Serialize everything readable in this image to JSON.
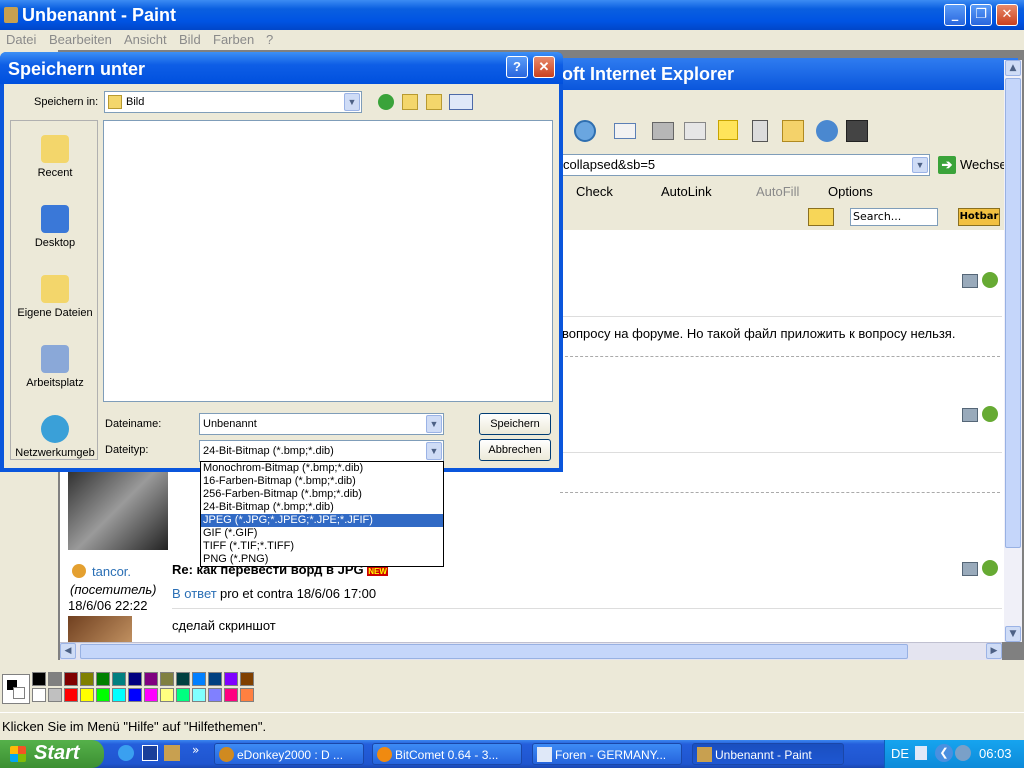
{
  "paint": {
    "title": "Unbenannt - Paint",
    "menu": [
      "Datei",
      "Bearbeiten",
      "Ansicht",
      "Bild",
      "Farben",
      "?"
    ],
    "status": "Klicken Sie im Menü \"Hilfe\" auf \"Hilfethemen\"."
  },
  "ie": {
    "title": "oft Internet Explorer",
    "address": "collapsed&sb=5",
    "go_label": "Wechse",
    "google": {
      "check": "Check",
      "autolink": "AutoLink",
      "autofill": "AutoFill",
      "options": "Options"
    },
    "hotbar": {
      "search_placeholder": "Search...",
      "hotbar_label": "Hotbar"
    },
    "post1_text": "вопросу на форуме. Но такой файл приложить к вопросу нельзя.",
    "post_user": "tancor.",
    "post_role": "(посетитель)",
    "post_date": "18/6/06 22:22",
    "reply_title": "Re: как перевести ворд в JPG",
    "reply_new_badge": "NEW",
    "reply_link": "В ответ",
    "reply_meta": "pro et contra 18/6/06 17:00",
    "reply_body": "сделай скриншот"
  },
  "dialog": {
    "title": "Speichern unter",
    "save_in_label": "Speichern in:",
    "save_in_value": "Bild",
    "places": [
      "Recent",
      "Desktop",
      "Eigene Dateien",
      "Arbeitsplatz",
      "Netzwerkumgeb"
    ],
    "filename_label": "Dateiname:",
    "filename_value": "Unbenannt",
    "filetype_label": "Dateityp:",
    "filetype_value": "24-Bit-Bitmap (*.bmp;*.dib)",
    "save_button": "Speichern",
    "cancel_button": "Abbrechen",
    "filetype_options": [
      "Monochrom-Bitmap (*.bmp;*.dib)",
      "16-Farben-Bitmap (*.bmp;*.dib)",
      "256-Farben-Bitmap (*.bmp;*.dib)",
      "24-Bit-Bitmap (*.bmp;*.dib)",
      "JPEG (*.JPG;*.JPEG;*.JPE;*.JFIF)",
      "GIF (*.GIF)",
      "TIFF (*.TIF;*.TIFF)",
      "PNG (*.PNG)"
    ],
    "selected_option_index": 4
  },
  "taskbar": {
    "start": "Start",
    "tasks": [
      "eDonkey2000 : D ...",
      "BitComet 0.64 - 3...",
      "Foren - GERMANY...",
      "Unbenannt - Paint"
    ],
    "active_task": 3,
    "lang": "DE",
    "clock": "06:03"
  },
  "palette_colors_top": [
    "#000000",
    "#808080",
    "#800000",
    "#808000",
    "#008000",
    "#008080",
    "#000080",
    "#800080",
    "#808040",
    "#004040",
    "#0080ff",
    "#004080",
    "#8000ff",
    "#804000"
  ],
  "palette_colors_bottom": [
    "#ffffff",
    "#c0c0c0",
    "#ff0000",
    "#ffff00",
    "#00ff00",
    "#00ffff",
    "#0000ff",
    "#ff00ff",
    "#ffff80",
    "#00ff80",
    "#80ffff",
    "#8080ff",
    "#ff0080",
    "#ff8040"
  ]
}
